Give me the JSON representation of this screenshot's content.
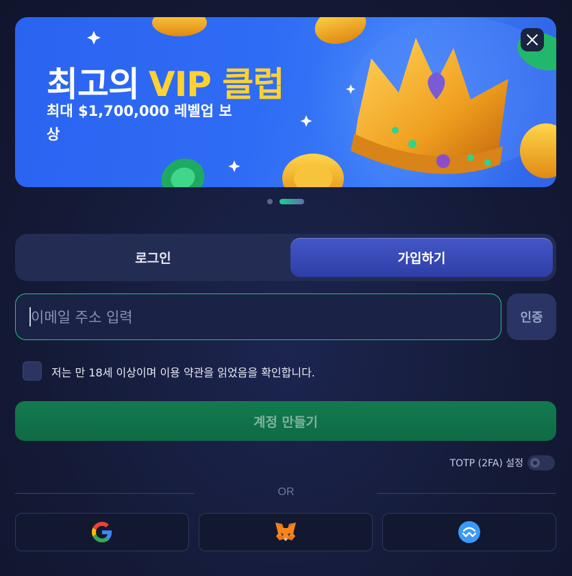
{
  "banner": {
    "title_part1": "최고의",
    "title_part2": "VIP 클럽",
    "subtitle": "최대 $1,700,000 레벨업 보상",
    "slides_total": 2,
    "active_slide": 2
  },
  "tabs": {
    "login_label": "로그인",
    "signup_label": "가입하기",
    "active": "signup"
  },
  "email": {
    "placeholder": "이메일 주소 입력",
    "value": "",
    "verify_label": "인증"
  },
  "terms": {
    "label": "저는 만 18세 이상이며 이용 약관을 읽었음을 확인합니다.",
    "checked": false
  },
  "create_button": {
    "label": "계정 만들기"
  },
  "totp": {
    "label": "TOTP (2FA) 설정",
    "enabled": false
  },
  "divider": {
    "label": "OR"
  },
  "social": {
    "providers": [
      "google-icon",
      "metamask-icon",
      "walletconnect-icon"
    ]
  },
  "colors": {
    "accent_green": "#23c58a",
    "banner_blue": "#2f6cf5",
    "vip_yellow": "#ffd232",
    "tab_active": "#3b4dbb"
  }
}
